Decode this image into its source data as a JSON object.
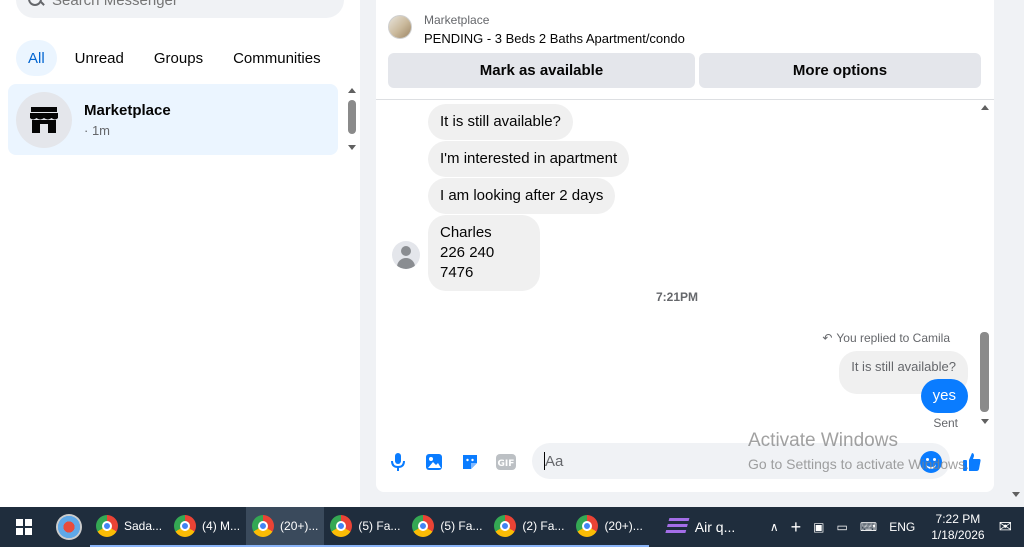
{
  "sidebar": {
    "search_placeholder": "Search Messenger",
    "filters": [
      "All",
      "Unread",
      "Groups",
      "Communities"
    ],
    "active_filter": "All",
    "conversation": {
      "name": "Marketplace",
      "time": "· 1m"
    }
  },
  "chat": {
    "header": {
      "label": "Marketplace",
      "title": "PENDING - 3 Beds 2 Baths Apartment/condo",
      "mark_available": "Mark as available",
      "more_options": "More options"
    },
    "messages": {
      "m1": "It is still available?",
      "m2": "I'm interested in apartment",
      "m3": "I am looking after 2 days",
      "m4_line1": "Charles",
      "m4_line2": "226 240 7476"
    },
    "timestamp": "7:21PM",
    "reply": {
      "note": "You replied to Camila",
      "quoted": "It is still available?",
      "text": "yes",
      "status": "Sent"
    },
    "composer": {
      "placeholder": "Aa"
    }
  },
  "watermark": {
    "line1": "Activate Windows",
    "line2": "Go to Settings to activate Windows."
  },
  "taskbar": {
    "apps": [
      "Sada...",
      "(4) M...",
      "(20+)...",
      "(5) Fa...",
      "(5) Fa...",
      "(2) Fa...",
      "(20+)..."
    ],
    "air_quality": "Air q...",
    "language": "ENG",
    "time": "7:22 PM",
    "date": "1/18/2026"
  },
  "colors": {
    "accent": "#0a7cff",
    "chip_active_bg": "#ebf5ff",
    "taskbar_bg": "#1f2d3d"
  }
}
